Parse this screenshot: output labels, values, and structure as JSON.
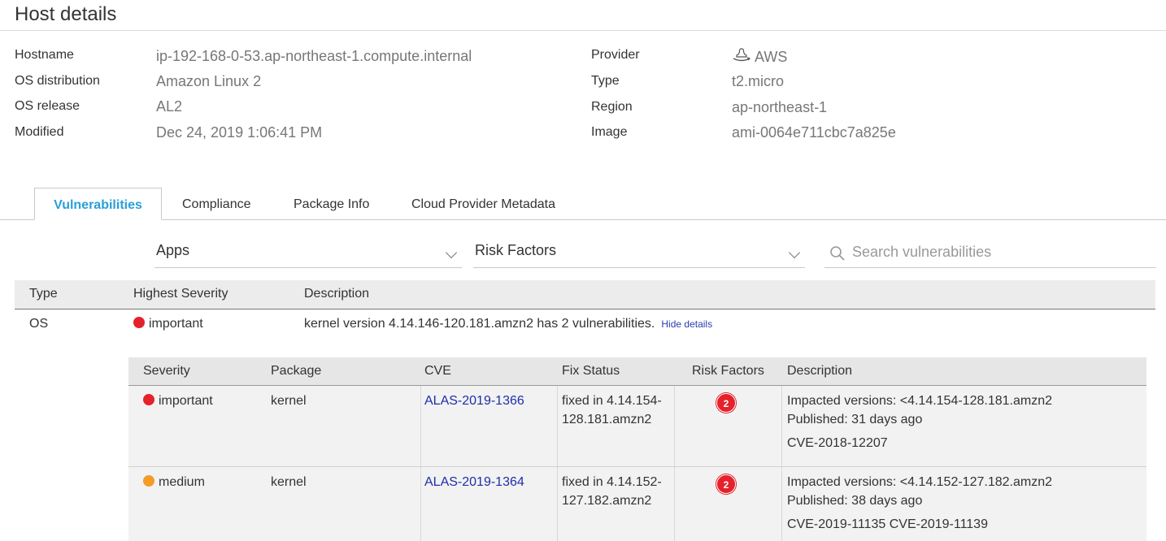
{
  "page": {
    "title": "Host details"
  },
  "host_info": {
    "left": [
      {
        "label": "Hostname",
        "value": "ip-192-168-0-53.ap-northeast-1.compute.internal"
      },
      {
        "label": "OS distribution",
        "value": "Amazon Linux 2"
      },
      {
        "label": "OS release",
        "value": "AL2"
      },
      {
        "label": "Modified",
        "value": "Dec 24, 2019 1:06:41 PM"
      }
    ],
    "right": [
      {
        "label": "Provider",
        "value": "AWS",
        "icon": "aws-logo-icon"
      },
      {
        "label": "Type",
        "value": "t2.micro"
      },
      {
        "label": "Region",
        "value": "ap-northeast-1"
      },
      {
        "label": "Image",
        "value": "ami-0064e711cbc7a825e"
      }
    ]
  },
  "tabs": [
    {
      "label": "Vulnerabilities",
      "active": true
    },
    {
      "label": "Compliance",
      "active": false
    },
    {
      "label": "Package Info",
      "active": false
    },
    {
      "label": "Cloud Provider Metadata",
      "active": false
    }
  ],
  "filters": {
    "apps_label": "Apps",
    "risk_label": "Risk Factors",
    "search_placeholder": "Search vulnerabilities"
  },
  "main_table": {
    "headers": [
      "Type",
      "Highest Severity",
      "Description"
    ],
    "row": {
      "type": "OS",
      "severity": "important",
      "description": "kernel version 4.14.146-120.181.amzn2 has 2 vulnerabilities.",
      "toggle_link": "Hide details"
    }
  },
  "detail_table": {
    "headers": [
      "Severity",
      "Package",
      "CVE",
      "Fix Status",
      "Risk Factors",
      "Description"
    ],
    "rows": [
      {
        "severity": "important",
        "package": "kernel",
        "cve": "ALAS-2019-1366",
        "fix_line1": "fixed in 4.14.154-",
        "fix_line2": "128.181.amzn2",
        "risk_count": "2",
        "desc_impacted": "Impacted versions: <4.14.154-128.181.amzn2",
        "desc_published": "Published: 31 days ago",
        "desc_cves": "CVE-2018-12207"
      },
      {
        "severity": "medium",
        "package": "kernel",
        "cve": "ALAS-2019-1364",
        "fix_line1": "fixed in 4.14.152-",
        "fix_line2": "127.182.amzn2",
        "risk_count": "2",
        "desc_impacted": "Impacted versions: <4.14.152-127.182.amzn2",
        "desc_published": "Published: 38 days ago",
        "desc_cves": "CVE-2019-11135 CVE-2019-11139"
      }
    ]
  },
  "colors": {
    "important": "#e5212b",
    "medium": "#f39c27",
    "accent": "#2a9fd8",
    "link": "#1e2fa8"
  }
}
